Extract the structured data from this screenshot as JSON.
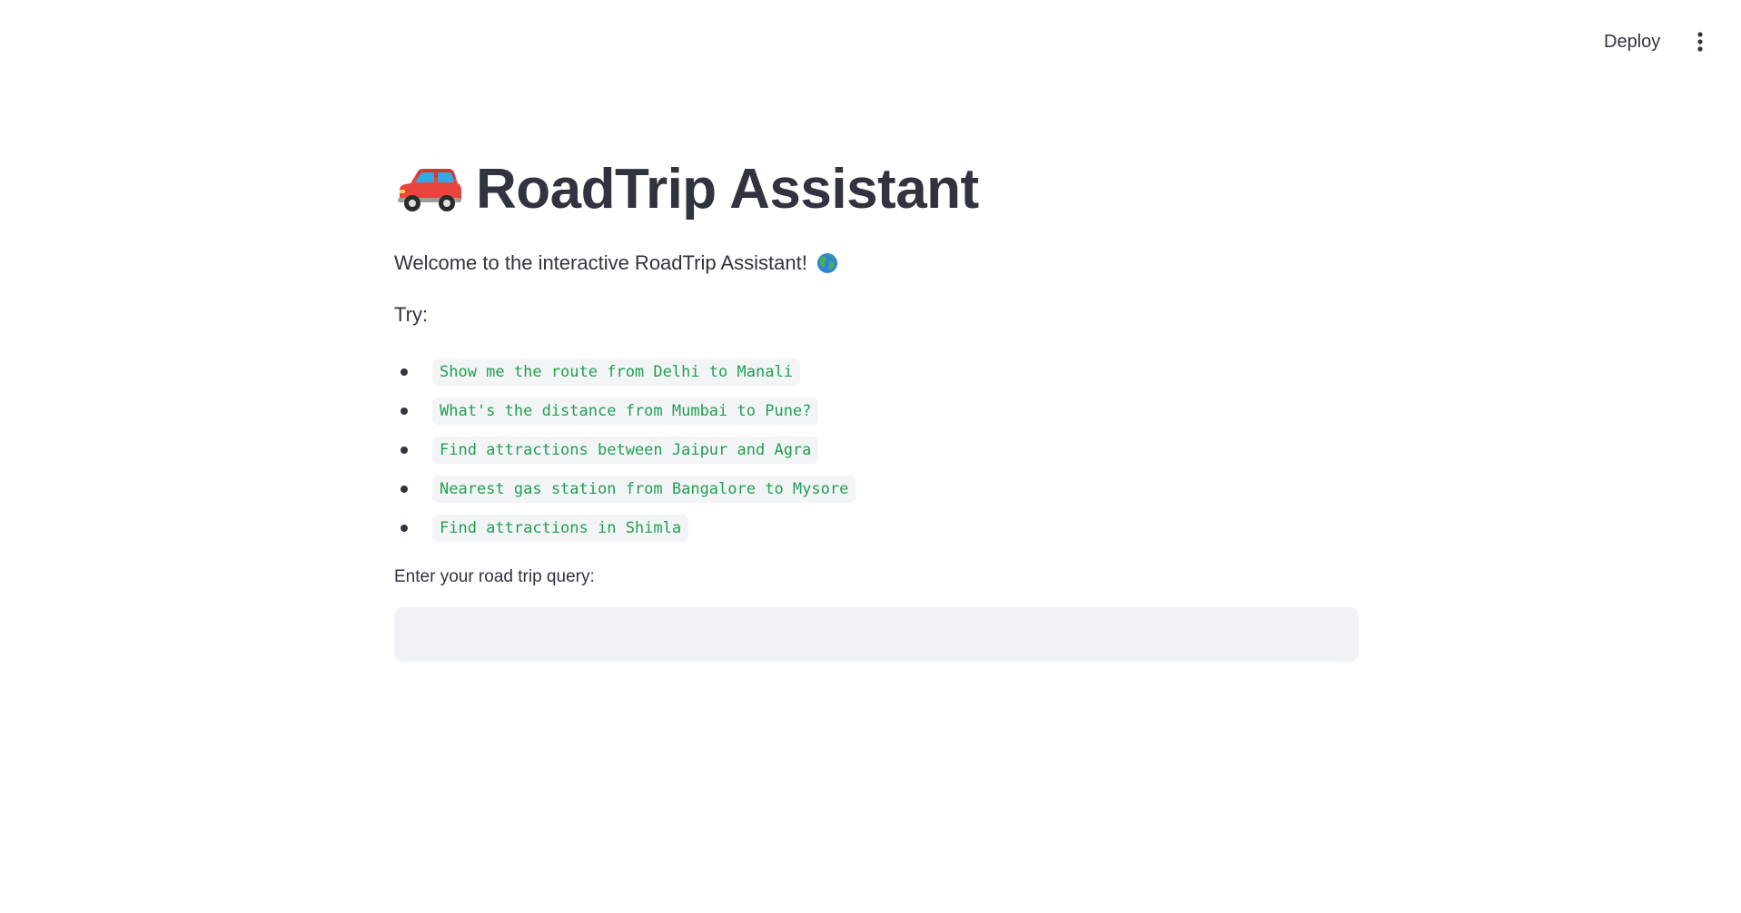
{
  "header": {
    "deploy_label": "Deploy",
    "menu_icon": "vertical-ellipsis-icon"
  },
  "main": {
    "title_icon": "red-car-icon",
    "title": "RoadTrip Assistant",
    "welcome_text": "Welcome to the interactive RoadTrip Assistant!",
    "welcome_icon": "globe-icon",
    "try_label": "Try:",
    "examples": [
      "Show me the route from Delhi to Manali",
      "What's the distance from Mumbai to Pune?",
      "Find attractions between Jaipur and Agra",
      "Nearest gas station from Bangalore to Mysore",
      "Find attractions in Shimla"
    ],
    "query_label": "Enter your road trip query:",
    "query_value": "",
    "query_placeholder": ""
  },
  "colors": {
    "text": "#31333f",
    "code_text": "#21a052",
    "code_bg": "#f3f4f6",
    "input_bg": "#f0f2f6",
    "car_red": "#e8453c"
  }
}
